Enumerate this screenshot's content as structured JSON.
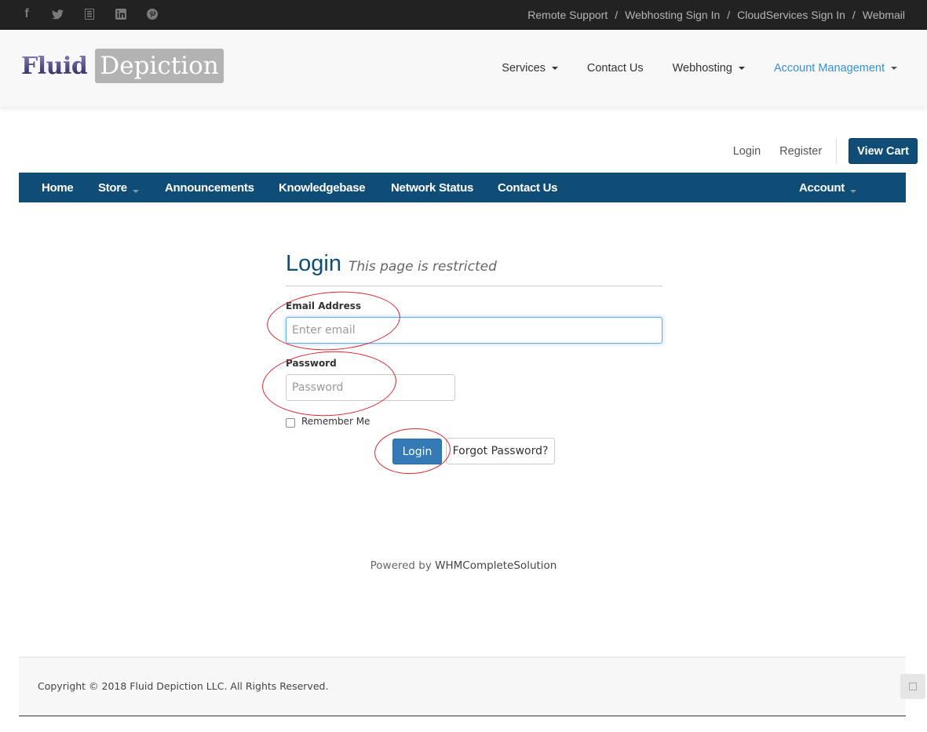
{
  "topbar": {
    "social": [
      {
        "name": "facebook",
        "glyph": "f"
      },
      {
        "name": "twitter"
      },
      {
        "name": "google-plus"
      },
      {
        "name": "linkedin"
      },
      {
        "name": "pinterest"
      }
    ],
    "links": [
      "Remote Support",
      "Webhosting Sign In",
      "CloudServices Sign In",
      "Webmail"
    ],
    "separator": "/"
  },
  "header": {
    "logo": {
      "part1": "Fluid",
      "part2": "Depiction"
    },
    "nav": [
      {
        "label": "Services",
        "dropdown": true,
        "active": false
      },
      {
        "label": "Contact Us",
        "dropdown": false,
        "active": false
      },
      {
        "label": "Webhosting",
        "dropdown": true,
        "active": false
      },
      {
        "label": "Account Management",
        "dropdown": true,
        "active": true
      }
    ]
  },
  "userbar": {
    "login": "Login",
    "register": "Register",
    "cart": "View Cart"
  },
  "bluenav": {
    "items": [
      {
        "label": "Home"
      },
      {
        "label": "Store",
        "dropdown": true
      },
      {
        "label": "Announcements"
      },
      {
        "label": "Knowledgebase"
      },
      {
        "label": "Network Status"
      },
      {
        "label": "Contact Us"
      }
    ],
    "account": {
      "label": "Account",
      "dropdown": true
    }
  },
  "login": {
    "title": "Login",
    "subtitle": "This page is restricted",
    "email_label": "Email Address",
    "email_placeholder": "Enter email",
    "email_value": "",
    "password_label": "Password",
    "password_placeholder": "Password",
    "password_value": "",
    "remember_label": "Remember Me",
    "remember_checked": false,
    "submit": "Login",
    "forgot": "Forgot Password?"
  },
  "powered": {
    "prefix": "Powered by ",
    "link": "WHMCompleteSolution"
  },
  "footer": {
    "copyright": "Copyright © 2018 Fluid Depiction LLC. All Rights Reserved."
  },
  "colors": {
    "brand": "#0f4d76",
    "primary": "#337ab7",
    "active_link": "#3b8fd1",
    "annotation": "#d7262b"
  }
}
